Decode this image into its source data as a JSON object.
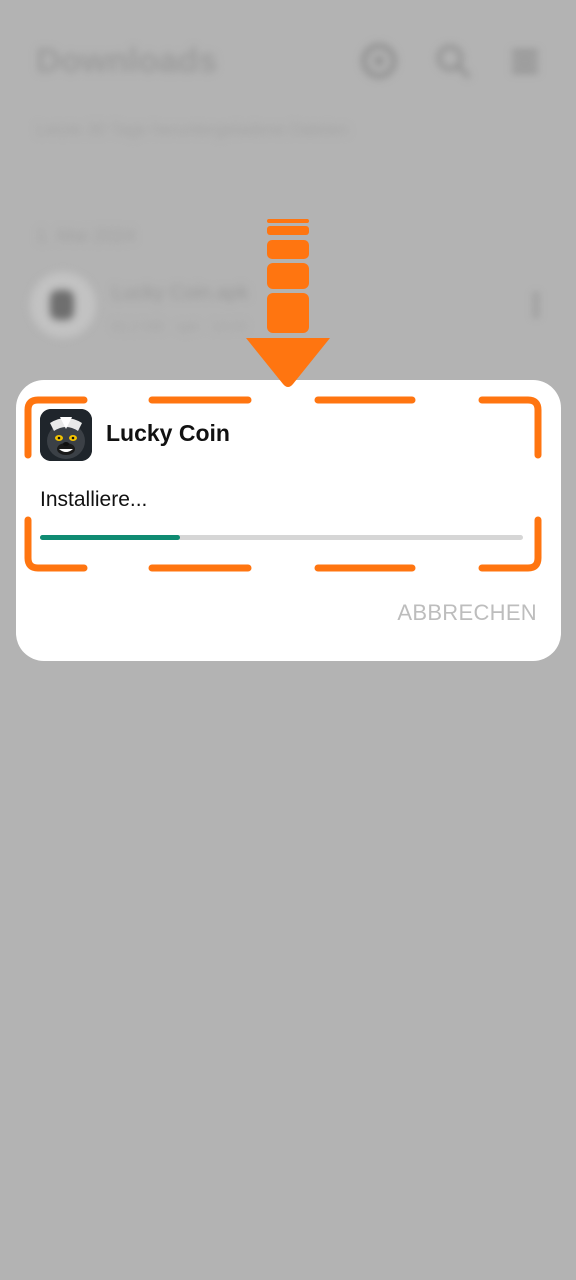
{
  "background": {
    "title": "Downloads",
    "subtitle": "Letzte 30 Tage heruntergeladene Dateien",
    "date_header": "1. Mai 2024",
    "file_name": "Lucky Coin.apk",
    "file_meta": "81,2 MB · apk · 10:23",
    "icons": [
      "settings-icon",
      "search-icon",
      "menu-icon",
      "more-vertical-icon"
    ]
  },
  "dialog": {
    "app_name": "Lucky Coin",
    "app_icon": "lucky-coin-app-icon",
    "status": "Installiere...",
    "progress": 0.29,
    "cancel_label": "ABBRECHEN"
  },
  "colors": {
    "scrim": "#b3b3b3",
    "accent_orange": "#ff7510",
    "progress_fill": "#0f8b72",
    "progress_track": "#d6d6d6",
    "cancel_text": "#bdbdbd"
  },
  "annotation": {
    "arrow_icon": "down-arrow-icon",
    "highlight": "dashed-highlight-frame"
  }
}
